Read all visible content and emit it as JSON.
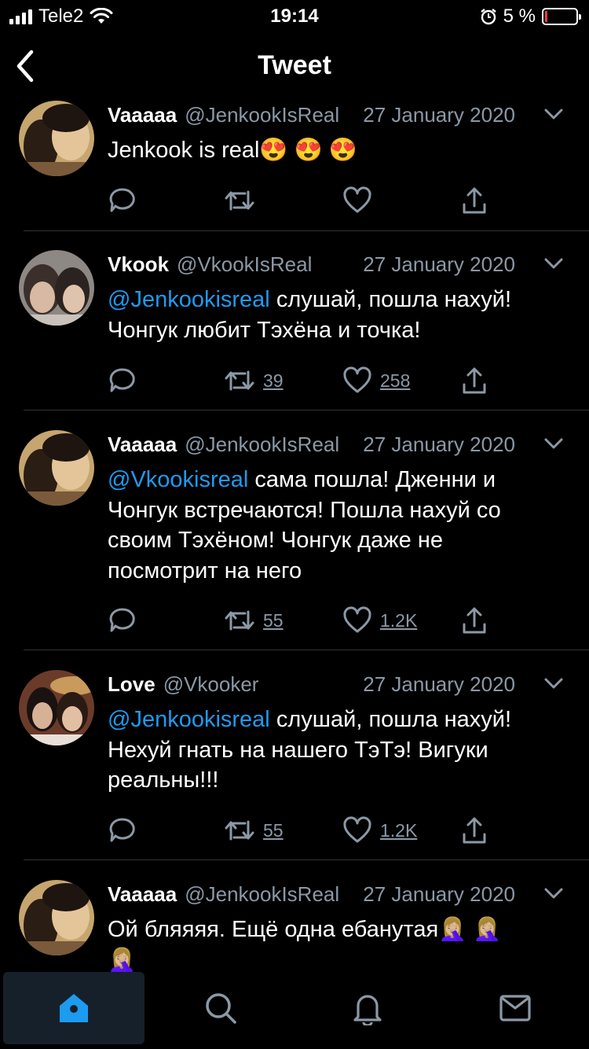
{
  "status_bar": {
    "carrier": "Tele2",
    "time": "19:14",
    "battery_percent": "5 %",
    "battery_level": 0.05
  },
  "header": {
    "title": "Tweet"
  },
  "tweets": [
    {
      "name": "Vaaaaa",
      "handle": "@JenkookIsReal",
      "date": "27 January 2020",
      "mention": "",
      "text": "Jenkook is real😍 😍 😍",
      "retweets": "",
      "likes": ""
    },
    {
      "name": "Vkook",
      "handle": "@VkookIsReal",
      "date": "27 January 2020",
      "mention": "@Jenkookisreal",
      "text": " слушай, пошла нахуй! Чонгук любит Тэхёна и точка!",
      "retweets": "39",
      "likes": "258"
    },
    {
      "name": "Vaaaaa",
      "handle": "@JenkookIsReal",
      "date": "27 January 2020",
      "mention": "@Vkookisreal",
      "text": " сама пошла! Дженни и Чонгук встречаются! Пошла нахуй со своим Тэхёном! Чонгук даже не посмотрит на него",
      "retweets": "55",
      "likes": "1.2K"
    },
    {
      "name": "Love",
      "handle": "@Vkooker",
      "date": "27 January 2020",
      "mention": "@Jenkookisreal",
      "text": " слушай, пошла нахуй! Нехуй гнать на нашего ТэТэ! Вигуки реальны!!!",
      "retweets": "55",
      "likes": "1.2K"
    },
    {
      "name": "Vaaaaa",
      "handle": "@JenkookIsReal",
      "date": "27 January 2020",
      "mention": "",
      "text": "Ой бляяяя. Ещё одна ебанутая🤦🏼‍♀️ 🤦🏼‍♀️ 🤦🏼‍♀️",
      "retweets": "",
      "likes": ""
    }
  ],
  "tab_bar": {
    "items": [
      "home-icon",
      "search-icon",
      "bell-icon",
      "mail-icon"
    ],
    "active": "home"
  },
  "colors": {
    "accent": "#1d9bf0",
    "secondary_text": "#8b98a5",
    "background": "#000000"
  }
}
